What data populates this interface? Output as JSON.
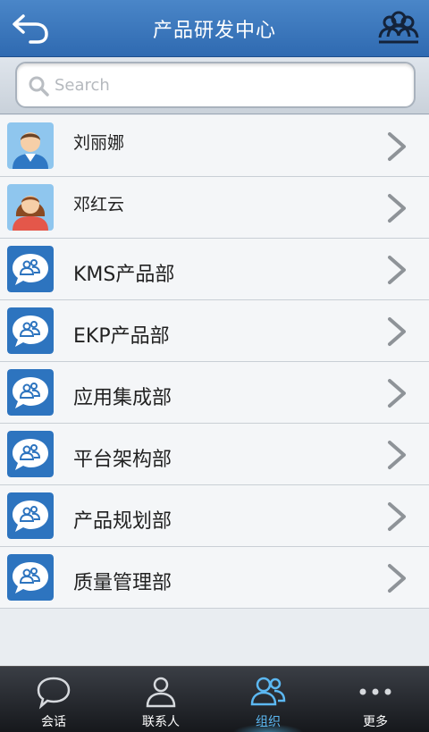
{
  "header": {
    "title": "产品研发中心",
    "back_icon": "back-arrow-icon",
    "right_icon": "organization-icon"
  },
  "search": {
    "placeholder": "Search",
    "value": ""
  },
  "list": [
    {
      "name": "刘丽娜",
      "type": "person",
      "icon": "male-avatar"
    },
    {
      "name": "邓红云",
      "type": "person",
      "icon": "female-avatar"
    },
    {
      "name": "KMS产品部",
      "type": "department",
      "icon": "group-chat-icon"
    },
    {
      "name": "EKP产品部",
      "type": "department",
      "icon": "group-chat-icon"
    },
    {
      "name": "应用集成部",
      "type": "department",
      "icon": "group-chat-icon"
    },
    {
      "name": "平台架构部",
      "type": "department",
      "icon": "group-chat-icon"
    },
    {
      "name": "产品规划部",
      "type": "department",
      "icon": "group-chat-icon"
    },
    {
      "name": "质量管理部",
      "type": "department",
      "icon": "group-chat-icon"
    }
  ],
  "tabs": [
    {
      "label": "会话",
      "icon": "chat-bubble-icon",
      "active": false
    },
    {
      "label": "联系人",
      "icon": "person-icon",
      "active": false
    },
    {
      "label": "组织",
      "icon": "group-icon",
      "active": true
    },
    {
      "label": "更多",
      "icon": "more-dots-icon",
      "active": false
    }
  ],
  "colors": {
    "header": "#3a78bf",
    "accent": "#5cb8f2",
    "tabbar": "#24272c"
  }
}
